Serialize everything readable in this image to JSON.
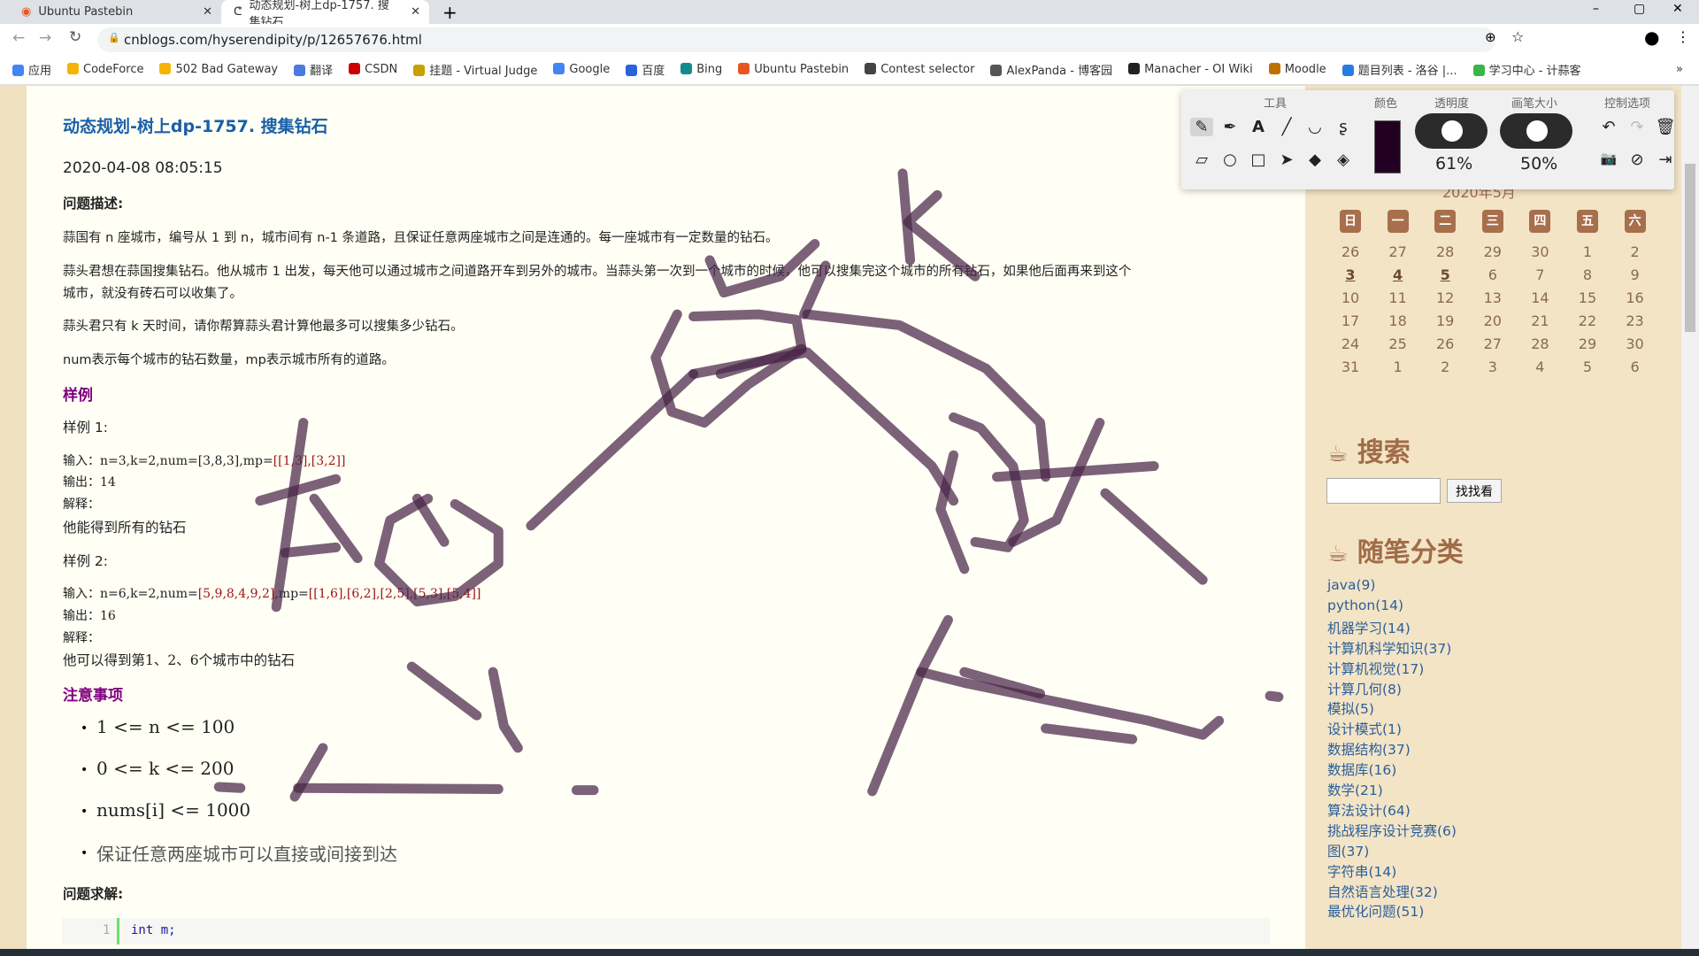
{
  "browser": {
    "tabs": [
      {
        "title": "Ubuntu Pastebin",
        "active": false
      },
      {
        "title": "动态规划-树上dp-1757. 搜集钻石",
        "active": true
      }
    ],
    "url": "cnblogs.com/hyserendipity/p/12657676.html",
    "bookmarks": [
      "应用",
      "CodeForce",
      "502 Bad Gateway",
      "翻译",
      "CSDN",
      "挂题 - Virtual Judge",
      "Google",
      "百度",
      "Bing",
      "Ubuntu Pastebin",
      "Contest selector",
      "AlexPanda - 博客园",
      "Manacher - OI Wiki",
      "Moodle",
      "题目列表 - 洛谷 |...",
      "学习中心 - 计蒜客"
    ]
  },
  "post": {
    "title": "动态规划-树上dp-1757. 搜集钻石",
    "date": "2020-04-08 08:05:15",
    "desc_heading": "问题描述:",
    "p1": "蒜国有 n 座城市，编号从 1 到 n，城市间有 n-1 条道路，且保证任意两座城市之间是连通的。每一座城市有一定数量的钻石。",
    "p2a": "蒜头君想在蒜国搜集钻石。他从城市 1 出发，每天他可以通过城市之间道路开车到另外的城市。当蒜头第一次到一个城市的时候，他可以搜集完这个城市的所有钻石，如果他后面再来到这个",
    "p2b": "城市，就没有砖石可以收集了。",
    "p3": "蒜头君只有 k 天时间，请你帮算蒜头君计算他最多可以搜集多少钻石。",
    "p4": "num表示每个城市的钻石数量，mp表示城市所有的道路。",
    "examples_heading": "样例",
    "ex1": {
      "label": "样例 1:",
      "input_prefix": "输入：n=3,k=2,num=[3,8,3],mp=",
      "input_red": "[[1,3],[3,2]]",
      "output": "输出：14",
      "explain": "解释：",
      "explain_text": "他能得到所有的钻石"
    },
    "ex2": {
      "label": "样例 2:",
      "input_prefix": "输入：n=6,k=2,num=",
      "input_red1": "[5,9,8,4,9,2]",
      "input_mid": ",mp=",
      "input_red2": "[[1,6],[6,2],[2,5],[5,3],[5,4]]",
      "output": "输出：16",
      "explain": "解释：",
      "explain_text": "他可以得到第1、2、6个城市中的钻石"
    },
    "notes_heading": "注意事项",
    "notes": [
      "1 <= n <= 100",
      "0 <= k <= 200",
      "nums[i] <= 1000",
      "保证任意两座城市可以直接或间接到达"
    ],
    "solution_heading": "问题求解:",
    "code": {
      "line": "1",
      "text": "int m;"
    }
  },
  "toolbar": {
    "sections": [
      "工具",
      "颜色",
      "透明度",
      "画笔大小",
      "控制选项"
    ],
    "color": "#220022",
    "opacity": "61%",
    "brush_size": "50%"
  },
  "calendar": {
    "month": "2020年5月",
    "weekdays": [
      "日",
      "一",
      "二",
      "三",
      "四",
      "五",
      "六"
    ],
    "weeks": [
      [
        "26",
        "27",
        "28",
        "29",
        "30",
        "1",
        "2"
      ],
      [
        "3",
        "4",
        "5",
        "6",
        "7",
        "8",
        "9"
      ],
      [
        "10",
        "11",
        "12",
        "13",
        "14",
        "15",
        "16"
      ],
      [
        "17",
        "18",
        "19",
        "20",
        "21",
        "22",
        "23"
      ],
      [
        "24",
        "25",
        "26",
        "27",
        "28",
        "29",
        "30"
      ],
      [
        "31",
        "1",
        "2",
        "3",
        "4",
        "5",
        "6"
      ]
    ],
    "today": "5"
  },
  "search": {
    "heading": "搜索",
    "button": "找找看",
    "value": ""
  },
  "categories": {
    "heading": "随笔分类",
    "items": [
      "java(9)",
      "python(14)",
      "机器学习(14)",
      "计算机科学知识(37)",
      "计算机视觉(17)",
      "计算几何(8)",
      "模拟(5)",
      "设计模式(1)",
      "数据结构(37)",
      "数据库(16)",
      "数学(21)",
      "算法设计(64)",
      "挑战程序设计竞赛(6)",
      "图(37)",
      "字符串(14)",
      "自然语言处理(32)",
      "最优化问题(51)"
    ]
  },
  "ink_color": "#4a2548"
}
